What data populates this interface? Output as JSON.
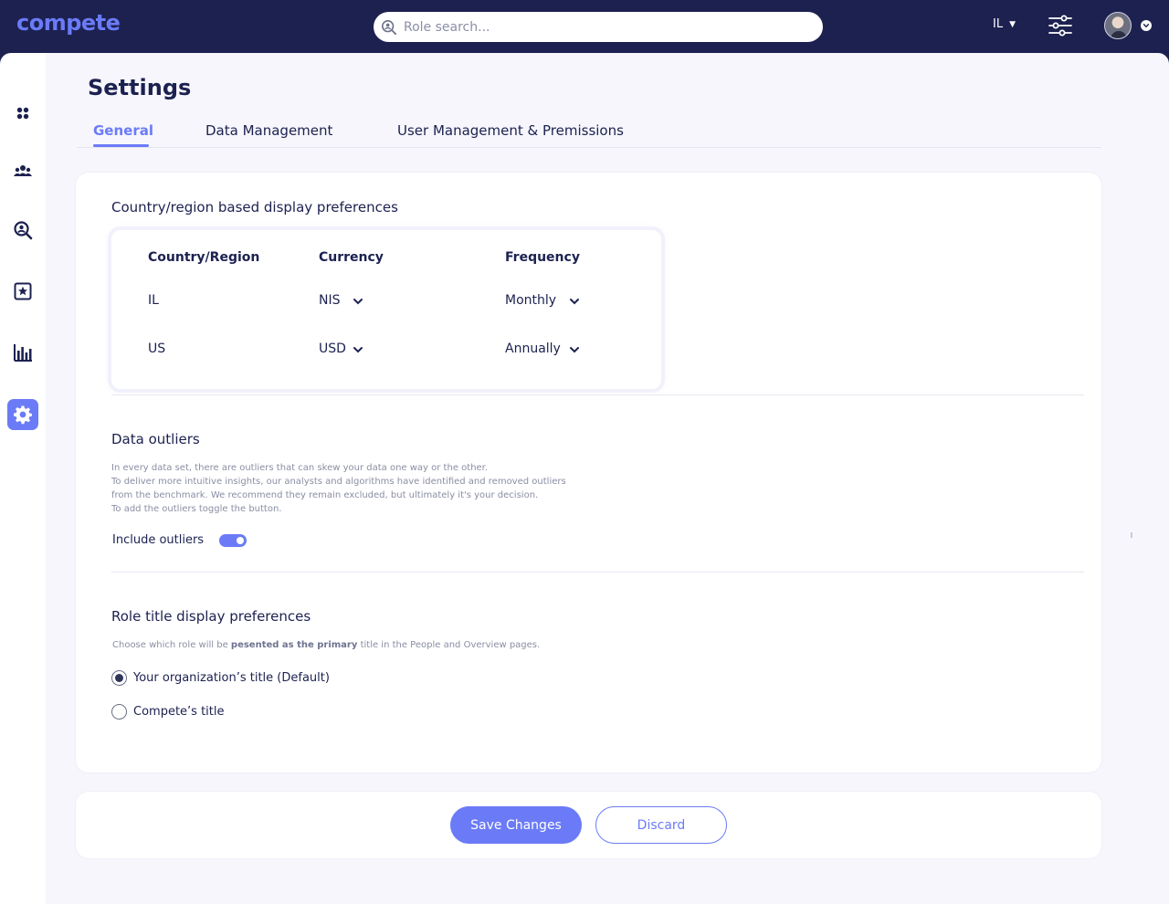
{
  "app": {
    "logo": "compete"
  },
  "header": {
    "search_placeholder": "Role search...",
    "locale": "IL",
    "icons": [
      "search-icon",
      "caret-down-icon",
      "filters-sliders-icon",
      "avatar",
      "chevron-down-icon"
    ]
  },
  "sidebar": {
    "items": [
      {
        "name": "dashboard",
        "icon": "dots-grid-icon",
        "active": false
      },
      {
        "name": "people",
        "icon": "team-icon",
        "active": false
      },
      {
        "name": "search",
        "icon": "person-search-icon",
        "active": false
      },
      {
        "name": "favorites",
        "icon": "star-box-icon",
        "active": false
      },
      {
        "name": "analytics",
        "icon": "bar-chart-icon",
        "active": false
      },
      {
        "name": "settings",
        "icon": "gear-icon",
        "active": true
      }
    ]
  },
  "page": {
    "title": "Settings",
    "tabs": [
      {
        "label": "General",
        "active": true
      },
      {
        "label": "Data Management",
        "active": false
      },
      {
        "label": "User Management & Premissions",
        "active": false
      }
    ]
  },
  "region_prefs": {
    "title": "Country/region based display preferences",
    "headers": {
      "country": "Country/Region",
      "currency": "Currency",
      "frequency": "Frequency"
    },
    "rows": [
      {
        "country": "IL",
        "currency": "NIS",
        "frequency": "Monthly"
      },
      {
        "country": "US",
        "currency": "USD",
        "frequency": "Annually"
      }
    ]
  },
  "outliers": {
    "title": "Data outliers",
    "description_lines": [
      "In every data set, there are outliers that can skew your data one way or the other.",
      "To deliver more intuitive insights, our analysts and algorithms have identified and removed outliers",
      "from the benchmark. We recommend they remain excluded, but ultimately it's your decision.",
      "To add the outliers toggle the button."
    ],
    "toggle_label": "Include outliers",
    "toggle_on": true
  },
  "role_title": {
    "title": "Role title display preferences",
    "desc_before": "Choose which role will be ",
    "desc_bold": "pesented as the primary",
    "desc_after": " title in the People and Overview pages.",
    "options": [
      {
        "label": "Your organization’s title (Default)",
        "checked": true
      },
      {
        "label": "Compete’s title",
        "checked": false
      }
    ]
  },
  "actions": {
    "save": "Save Changes",
    "discard": "Discard"
  },
  "colors": {
    "navy": "#1c2150",
    "accent": "#6b7bf7",
    "page_bg": "#f6f6fc"
  }
}
